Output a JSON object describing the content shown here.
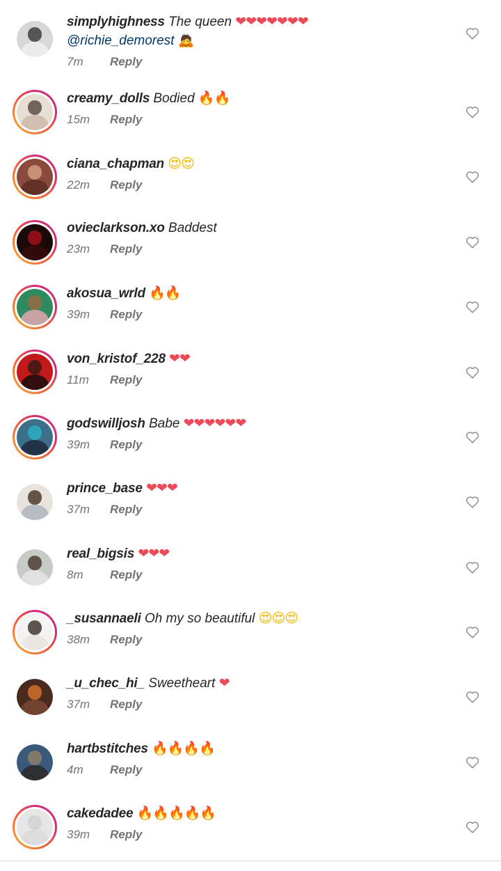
{
  "reply_label": "Reply",
  "colors": {
    "username": "#262626",
    "meta": "#737373",
    "mention": "#00376b",
    "heart_emoji": "#ed4956"
  },
  "comments": [
    {
      "username": "simplyhighness",
      "text": "The queen",
      "emoji": "❤❤❤❤❤❤❤",
      "emoji_kind": "heart",
      "mention": "@richie_demorest",
      "mention_emoji": "🙇",
      "time": "7m",
      "story_ring": false,
      "avatar_colors": [
        "#d7d7d7",
        "#2a2a2a",
        "#f1f1f1"
      ]
    },
    {
      "username": "creamy_dolls",
      "text": "Bodied",
      "emoji": "🔥🔥",
      "emoji_kind": "fire",
      "time": "15m",
      "story_ring": true,
      "avatar_colors": [
        "#e9ded3",
        "#4a3a35",
        "#c9b7a5"
      ]
    },
    {
      "username": "ciana_chapman",
      "text": "",
      "emoji": "😍😍",
      "emoji_kind": "eyes",
      "time": "22m",
      "story_ring": true,
      "avatar_colors": [
        "#8a4b3c",
        "#d9a68a",
        "#5a2b20"
      ]
    },
    {
      "username": "ovieclarkson.xo",
      "text": "Baddest",
      "emoji": "",
      "emoji_kind": "",
      "time": "23m",
      "story_ring": true,
      "avatar_colors": [
        "#1a0a0a",
        "#b3121c",
        "#3b0b0b"
      ]
    },
    {
      "username": "akosua_wrld",
      "text": "",
      "emoji": "🔥🔥",
      "emoji_kind": "fire",
      "time": "39m",
      "story_ring": true,
      "avatar_colors": [
        "#2f8a5f",
        "#a7663f",
        "#f0a6b5"
      ]
    },
    {
      "username": "von_kristof_228",
      "text": "",
      "emoji": "❤❤",
      "emoji_kind": "heart",
      "time": "11m",
      "story_ring": true,
      "avatar_colors": [
        "#c21a1a",
        "#2a1a16",
        "#0c0c0c"
      ]
    },
    {
      "username": "godswilljosh",
      "text": "Babe",
      "emoji": "❤❤❤❤❤❤",
      "emoji_kind": "heart",
      "time": "39m",
      "story_ring": true,
      "avatar_colors": [
        "#3c6f8a",
        "#2bb5c8",
        "#1c2633"
      ]
    },
    {
      "username": "prince_base",
      "text": "",
      "emoji": "❤❤❤",
      "emoji_kind": "heart",
      "time": "37m",
      "story_ring": false,
      "avatar_colors": [
        "#e8e3dd",
        "#3a2418",
        "#aab2bb"
      ]
    },
    {
      "username": "real_bigsis",
      "text": "",
      "emoji": "❤❤❤",
      "emoji_kind": "heart",
      "time": "8m",
      "story_ring": false,
      "avatar_colors": [
        "#c6cbc6",
        "#3b2a22",
        "#e6e6e6"
      ]
    },
    {
      "username": "_susannaeli",
      "text": "Oh my so beautiful",
      "emoji": "😍😍😍",
      "emoji_kind": "eyes",
      "time": "38m",
      "story_ring": true,
      "avatar_colors": [
        "#f3f3f3",
        "#2b1f1a",
        "#e7e2dc"
      ]
    },
    {
      "username": "_u_chec_hi_",
      "text": "Sweetheart",
      "emoji": "❤",
      "emoji_kind": "heart",
      "time": "37m",
      "story_ring": false,
      "avatar_colors": [
        "#4a2a1e",
        "#e27a2c",
        "#7a4a36"
      ]
    },
    {
      "username": "hartbstitches",
      "text": "",
      "emoji": "🔥🔥🔥🔥",
      "emoji_kind": "fire",
      "time": "4m",
      "story_ring": false,
      "avatar_colors": [
        "#3a5a7a",
        "#9a8468",
        "#2a2522"
      ]
    },
    {
      "username": "cakedadee",
      "text": "",
      "emoji": "🔥🔥🔥🔥🔥",
      "emoji_kind": "fire",
      "time": "39m",
      "story_ring": true,
      "avatar_colors": [
        "#e6e6e6",
        "#cfcfcf",
        "#dadada"
      ]
    }
  ]
}
